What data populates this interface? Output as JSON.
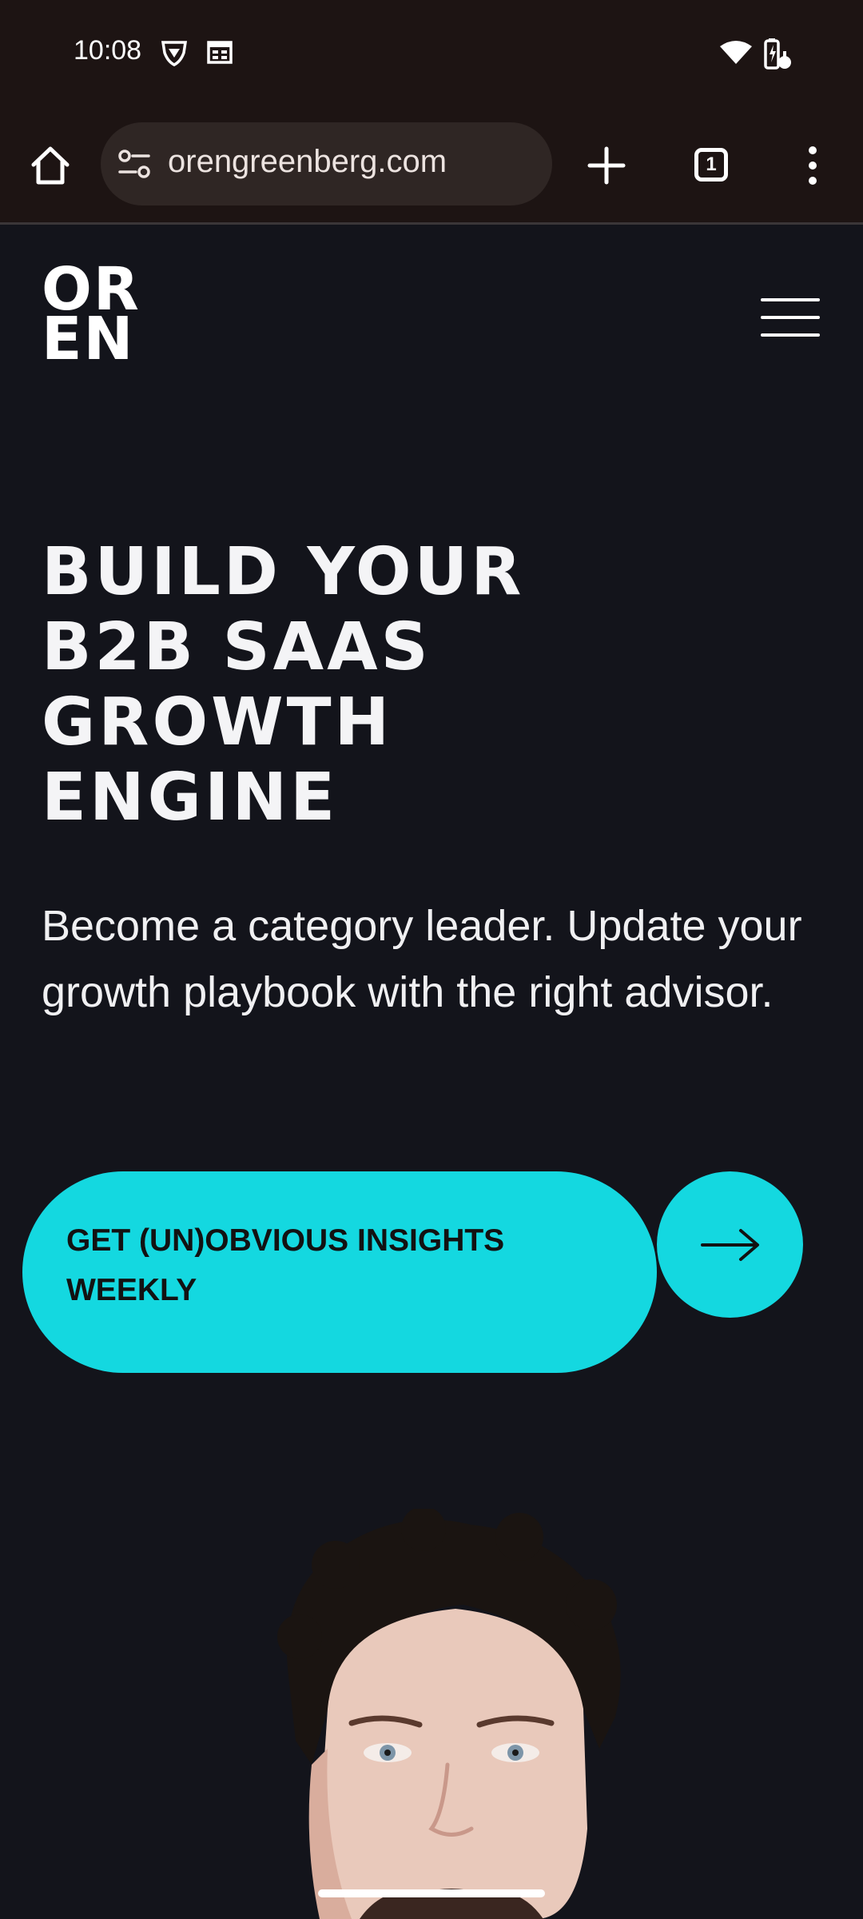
{
  "status_bar": {
    "time": "10:08",
    "icons": [
      "vpn-shield-icon",
      "calendar-icon",
      "wifi-icon",
      "battery-icon"
    ]
  },
  "browser": {
    "url": "orengreenberg.com",
    "tab_count": "1",
    "icons": [
      "home-icon",
      "site-settings-icon",
      "new-tab-icon",
      "tab-switcher-icon",
      "overflow-menu-icon"
    ]
  },
  "site": {
    "logo": {
      "line1": "OR",
      "line2": "EN"
    },
    "menu_icon": "hamburger-menu-icon",
    "headline": [
      "BUILD YOUR",
      "B2B SAAS",
      "GROWTH",
      "ENGINE"
    ],
    "subheadline": "Become a category leader. Update your growth playbook with the right advisor.",
    "cta": {
      "label": "GET (UN)OBVIOUS INSIGHTS WEEKLY",
      "arrow_icon": "arrow-right-icon"
    }
  },
  "colors": {
    "page_background": "#13141b",
    "browser_chrome": "#1d1413",
    "accent": "#14d8e0",
    "text": "#ffffff"
  }
}
